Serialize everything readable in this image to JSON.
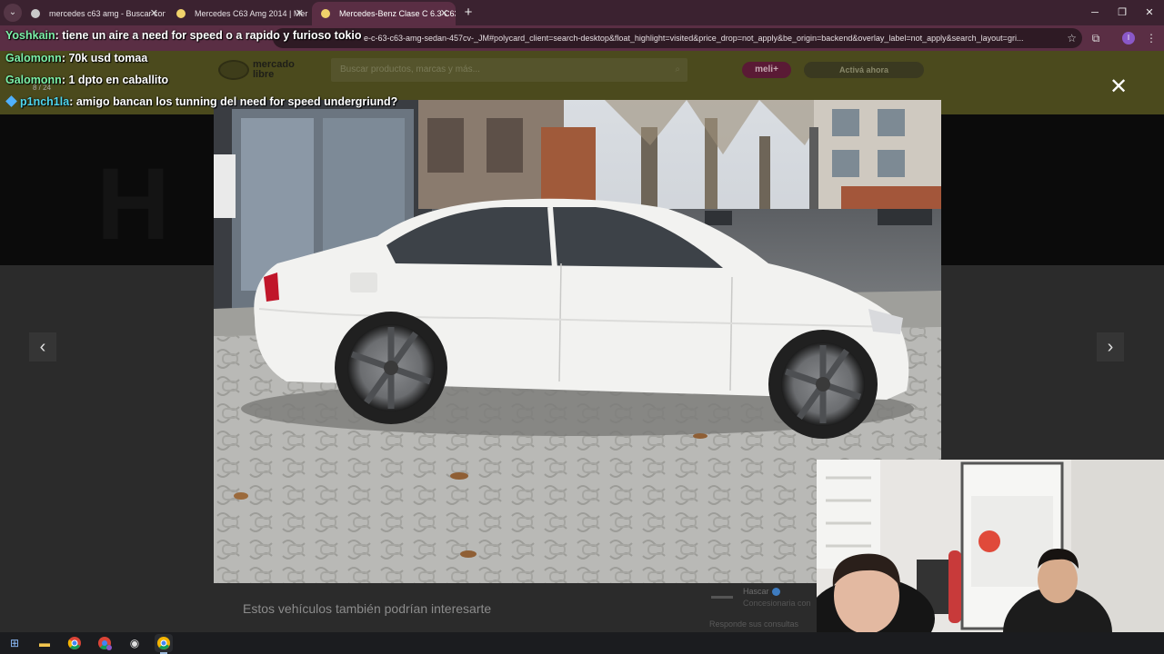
{
  "browser": {
    "tabs": [
      {
        "title": "mercedes c63 amg - Buscar con"
      },
      {
        "title": "Mercedes C63 Amg 2014 | Mer"
      },
      {
        "title": "Mercedes-Benz Clase C 6.3 C63"
      }
    ],
    "url": "e-c-63-c63-amg-sedan-457cv-_JM#polycard_client=search-desktop&float_highlight=visited&price_drop=not_apply&be_origin=backend&overlay_label=not_apply&search_layout=gri...",
    "profile_initial": "I"
  },
  "site": {
    "logo_line1": "mercado",
    "logo_line2": "libre",
    "search_placeholder": "Buscar productos, marcas y más...",
    "meli_badge": "meli+",
    "activa_button": "Activá ahora",
    "suggest_title": "Estos vehículos también podrían interesarte",
    "seller_name": "Hascar",
    "seller_sub": "Concesionaria con",
    "seller_resp": "Responde sus consultas",
    "counter": "8 / 24"
  },
  "chat": [
    {
      "user": "Yoshkain",
      "text": ": tiene un aire a need for speed o a rapido y furioso tokio",
      "color": "green"
    },
    {
      "user": "Galomonn",
      "text": ": 70k usd tomaa",
      "color": "green"
    },
    {
      "user": "Galomonn",
      "text": ": 1 dpto en caballito",
      "color": "green"
    },
    {
      "user": "p1nch1la",
      "text": ": amigo bancan los tunning del need for speed undergriund?",
      "color": "teal"
    }
  ]
}
